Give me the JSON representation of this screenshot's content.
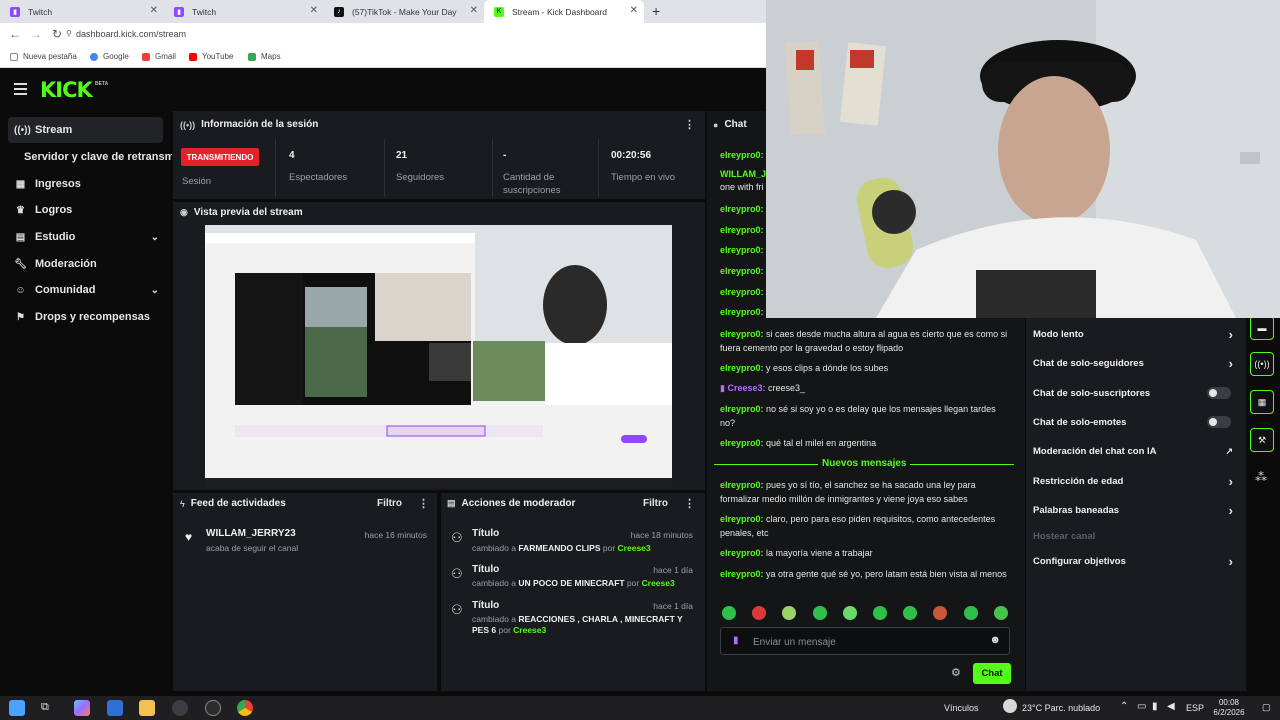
{
  "browser": {
    "tabs": [
      {
        "label": "Twitch"
      },
      {
        "label": "Twitch"
      },
      {
        "label": "(57)TikTok - Make Your Day"
      },
      {
        "label": "Stream - Kick Dashboard"
      }
    ],
    "url": "dashboard.kick.com/stream",
    "bookmarks": [
      "Nueva pestaña",
      "Google",
      "Gmail",
      "YouTube",
      "Maps"
    ]
  },
  "brand": {
    "logo": "KICK",
    "beta": "BETA",
    "accent": "#53fc18"
  },
  "sidebar": {
    "items": [
      {
        "label": "Stream",
        "icon": "broadcast-icon"
      },
      {
        "label": "Servidor y clave de retransmisión"
      },
      {
        "label": "Ingresos",
        "icon": "chart-icon"
      },
      {
        "label": "Logros",
        "icon": "trophy-icon"
      },
      {
        "label": "Estudio",
        "icon": "studio-icon"
      },
      {
        "label": "Moderación",
        "icon": "wrench-icon"
      },
      {
        "label": "Comunidad",
        "icon": "users-icon"
      },
      {
        "label": "Drops y recompensas",
        "icon": "gift-icon"
      }
    ]
  },
  "session": {
    "title": "Información de la sesión",
    "status": "TRANSMITIENDO",
    "status_label": "Sesión",
    "viewers": "4",
    "viewers_label": "Espectadores",
    "followers": "21",
    "followers_label": "Seguidores",
    "subs": "-",
    "subs_label": "Cantidad de suscripciones",
    "uptime": "00:20:56",
    "uptime_label": "Tiempo en vivo"
  },
  "preview": {
    "title": "Vista previa del stream"
  },
  "feed": {
    "title": "Feed de actividades",
    "filter": "Filtro",
    "items": [
      {
        "user": "WILLAM_JERRY23",
        "action": "acaba de seguir el canal",
        "time": "hace 16 minutos"
      }
    ]
  },
  "modactions": {
    "title": "Acciones de moderador",
    "filter": "Filtro",
    "items": [
      {
        "heading": "Título",
        "pre": "cambiado a",
        "value": "FARMEANDO CLIPS",
        "by": "por",
        "user": "Creese3",
        "time": "hace 18 minutos"
      },
      {
        "heading": "Título",
        "pre": "cambiado a",
        "value": "UN POCO DE MINECRAFT",
        "by": "por",
        "user": "Creese3",
        "time": "hace 1 día"
      },
      {
        "heading": "Título",
        "pre": "cambiado a",
        "value": "REACCIONES , CHARLA , MINECRAFT Y PES 6",
        "by": "por",
        "user": "Creese3",
        "time": "hace 1 día"
      }
    ]
  },
  "chat": {
    "title": "Chat",
    "short_messages": [
      {
        "user": "elreypro0:",
        "text": ""
      },
      {
        "user": "WILLAM_J",
        "text": "one with fri"
      },
      {
        "user": "elreypro0:",
        "text": ""
      },
      {
        "user": "elreypro0:",
        "text": ""
      },
      {
        "user": "elreypro0:",
        "text": ""
      },
      {
        "user": "elreypro0:",
        "text": ""
      },
      {
        "user": "elreypro0:",
        "text": ""
      },
      {
        "user": "elreypro0:",
        "text": ""
      }
    ],
    "messages": [
      {
        "user": "elreypro0:",
        "text": "si caes desde mucha altura al agua es cierto que es como si fuera cemento por la gravedad o estoy flipado"
      },
      {
        "user": "elreypro0:",
        "text": "y esos clips a dónde los subes"
      },
      {
        "user": "Creese3:",
        "text": "creese3_"
      },
      {
        "user": "elreypro0:",
        "text": "no sé si soy yo o es delay que los mensajes llegan tardes no?"
      },
      {
        "user": "elreypro0:",
        "text": "qué tal el milei en argentina"
      }
    ],
    "new_messages_label": "Nuevos mensajes",
    "new_messages": [
      {
        "user": "elreypro0:",
        "text": "pues yo sí tío, el sanchez se ha sacado una ley para formalizar medio millón de inmigrantes y viene joya eso sabes"
      },
      {
        "user": "elreypro0:",
        "text": "claro, pero para eso piden requisitos, como antecedentes penales, etc"
      },
      {
        "user": "elreypro0:",
        "text": "la mayoría viene a trabajar"
      },
      {
        "user": "elreypro0:",
        "text": "ya otra gente qué sé yo, pero latam está bien vista al menos"
      }
    ],
    "input_placeholder": "Enviar un mensaje",
    "send_label": "Chat"
  },
  "settings": {
    "rows": [
      {
        "label": "Modo lento",
        "control": "arrow"
      },
      {
        "label": "Chat de solo-seguidores",
        "control": "arrow"
      },
      {
        "label": "Chat de solo-suscriptores",
        "control": "toggle"
      },
      {
        "label": "Chat de solo-emotes",
        "control": "toggle"
      },
      {
        "label": "Moderación del chat con IA",
        "control": "external"
      },
      {
        "label": "Restricción de edad",
        "control": "arrow"
      },
      {
        "label": "Palabras baneadas",
        "control": "arrow"
      },
      {
        "label": "Hostear canal",
        "control": "disabled"
      },
      {
        "label": "Configurar objetivos",
        "control": "arrow"
      }
    ]
  },
  "taskbar": {
    "links": "Vínculos",
    "weather": "23°C  Parc. nublado",
    "lang": "ESP",
    "time": "00:08",
    "date": "6/2/2026"
  }
}
